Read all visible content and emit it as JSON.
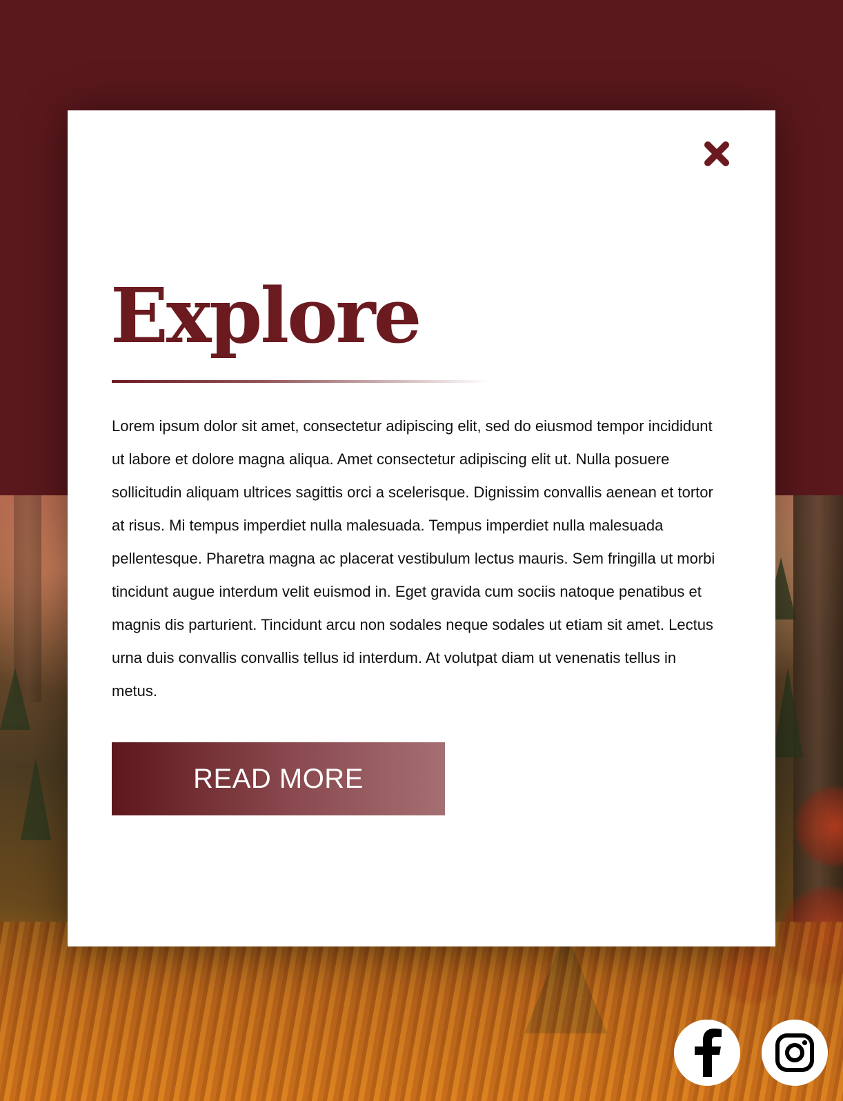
{
  "modal": {
    "title": "Explore",
    "body": "Lorem ipsum dolor sit amet, consectetur adipiscing elit, sed do eiusmod tempor incididunt ut labore et dolore magna aliqua. Amet consectetur adipiscing elit ut. Nulla posuere sollicitudin aliquam ultrices sagittis orci a scelerisque. Dignissim convallis aenean et tortor at risus. Mi tempus imperdiet nulla malesuada. Tempus imperdiet nulla malesuada pellentesque. Pharetra magna ac placerat vestibulum lectus mauris. Sem fringilla ut morbi tincidunt augue interdum velit euismod in. Eget gravida cum sociis natoque penatibus et magnis dis parturient. Tincidunt arcu non sodales neque sodales ut etiam sit amet. Lectus urna duis convallis convallis tellus id interdum. At volutpat diam ut venenatis tellus in metus.",
    "button_label": "READ MORE",
    "close_icon": "close-icon"
  },
  "social": {
    "facebook_icon": "facebook-icon",
    "instagram_icon": "instagram-icon"
  },
  "colors": {
    "accent": "#6b1a1f",
    "band": "#5b181c",
    "modal_bg": "#ffffff"
  }
}
